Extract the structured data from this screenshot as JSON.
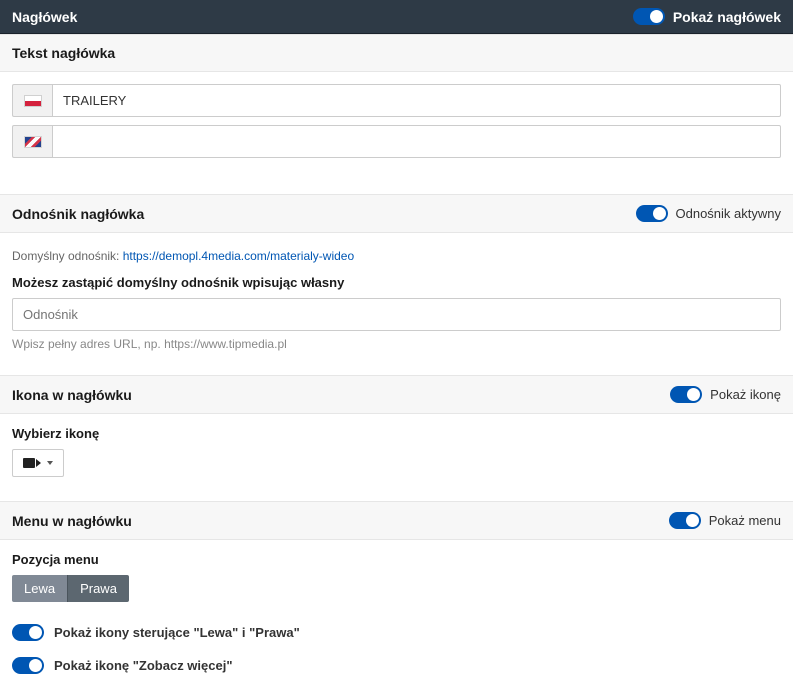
{
  "header": {
    "title": "Nagłówek",
    "show_toggle_label": "Pokaż nagłówek"
  },
  "text_section": {
    "title": "Tekst nagłówka",
    "inputs": {
      "pl_value": "TRAILERY",
      "en_value": ""
    }
  },
  "link_section": {
    "title": "Odnośnik nagłówka",
    "active_toggle_label": "Odnośnik aktywny",
    "default_prefix": "Domyślny odnośnik: ",
    "default_url": "https://demopl.4media.com/materialy-wideo",
    "override_label": "Możesz zastąpić domyślny odnośnik wpisując własny",
    "input_placeholder": "Odnośnik",
    "helper": "Wpisz pełny adres URL, np. https://www.tipmedia.pl"
  },
  "icon_section": {
    "title": "Ikona w nagłówku",
    "show_toggle_label": "Pokaż ikonę",
    "choose_label": "Wybierz ikonę"
  },
  "menu_section": {
    "title": "Menu w nagłówku",
    "show_toggle_label": "Pokaż menu",
    "position_label": "Pozycja menu",
    "pos_left": "Lewa",
    "pos_right": "Prawa",
    "opt_nav_icons": "Pokaż ikony sterujące \"Lewa\" i \"Prawa\"",
    "opt_see_more": "Pokaż ikonę \"Zobacz więcej\""
  }
}
